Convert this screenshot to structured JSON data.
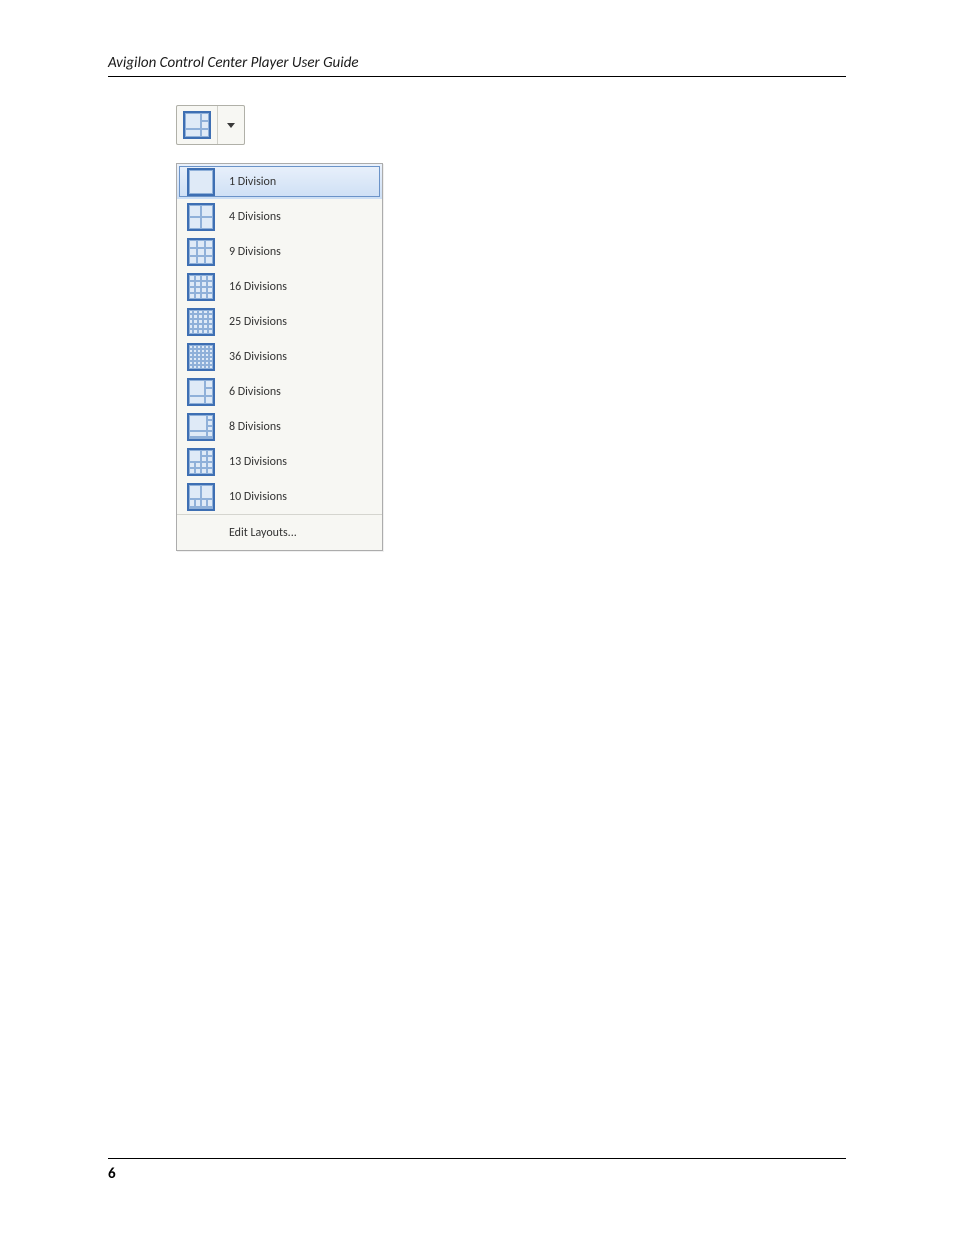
{
  "header": {
    "title": "Avigilon Control Center Player User Guide"
  },
  "toolbar": {
    "active_layout": "6 Divisions"
  },
  "menu": {
    "items": [
      {
        "label": "1 Division"
      },
      {
        "label": "4 Divisions"
      },
      {
        "label": "9 Divisions"
      },
      {
        "label": "16 Divisions"
      },
      {
        "label": "25 Divisions"
      },
      {
        "label": "36 Divisions"
      },
      {
        "label": "6 Divisions"
      },
      {
        "label": "8 Divisions"
      },
      {
        "label": "13 Divisions"
      },
      {
        "label": "10 Divisions"
      },
      {
        "label": "Edit Layouts..."
      }
    ],
    "selected_index": 0
  },
  "footer": {
    "page_number": "6"
  }
}
